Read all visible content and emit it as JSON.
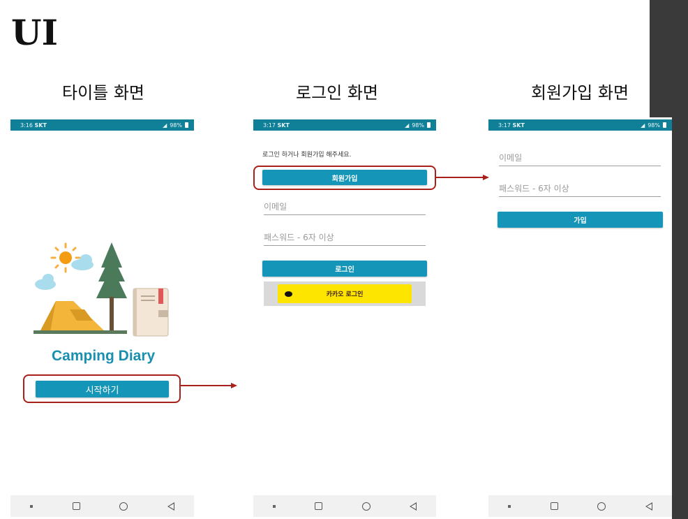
{
  "slide": {
    "title": "UI"
  },
  "captions": {
    "title_screen": "타이틀 화면",
    "login_screen": "로그인 화면",
    "signup_screen": "회원가입 화면"
  },
  "statusbar": {
    "screen1": {
      "time": "3:16",
      "carrier": "SKT"
    },
    "screen2": {
      "time": "3:17",
      "carrier": "SKT"
    },
    "screen3": {
      "time": "3:17",
      "carrier": "SKT"
    },
    "battery": "98%"
  },
  "title_screen": {
    "app_name": "Camping Diary",
    "start_button": "시작하기"
  },
  "login_screen": {
    "hint": "로그인 하거나 회원가입 해주세요.",
    "signup_button": "회원가입",
    "email_placeholder": "이메일",
    "password_placeholder": "패스워드 - 6자 이상",
    "login_button": "로그인",
    "kakao_button": "카카오 로그인"
  },
  "signup_screen": {
    "email_placeholder": "이메일",
    "password_placeholder": "패스워드 - 6자 이상",
    "join_button": "가입"
  },
  "colors": {
    "statusbar": "#107f98",
    "accent": "#1595b7",
    "highlight": "#a8201a",
    "kakao": "#fee500"
  },
  "icons": [
    "camping-illustration-icon",
    "wifi-icon",
    "signal-icon",
    "battery-icon",
    "kakao-chat-icon",
    "recents-icon",
    "home-icon",
    "back-icon"
  ]
}
